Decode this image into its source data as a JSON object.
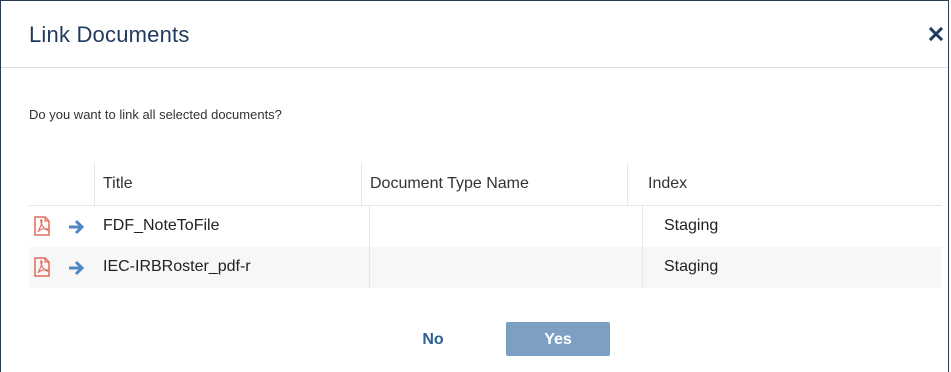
{
  "dialog": {
    "title": "Link Documents",
    "close_icon": "close-icon",
    "question": "Do you want to link all selected documents?"
  },
  "table": {
    "columns": [
      "Title",
      "Document Type Name",
      "Index"
    ],
    "rows": [
      {
        "pdf_icon": "pdf-file-icon",
        "arrow_icon": "arrow-right-icon",
        "title": "FDF_NoteToFile",
        "document_type_name": "",
        "index": "Staging"
      },
      {
        "pdf_icon": "pdf-file-icon",
        "arrow_icon": "arrow-right-icon",
        "title": "IEC-IRBRoster_pdf-r",
        "document_type_name": "",
        "index": "Staging"
      }
    ]
  },
  "buttons": {
    "no_label": "No",
    "yes_label": "Yes"
  },
  "colors": {
    "title": "#1f3a5f",
    "pdf_icon": "#e06b5e",
    "arrow_icon": "#4f86c6",
    "yes_button": "#7e9fc4",
    "no_button_text": "#2f5f94"
  }
}
